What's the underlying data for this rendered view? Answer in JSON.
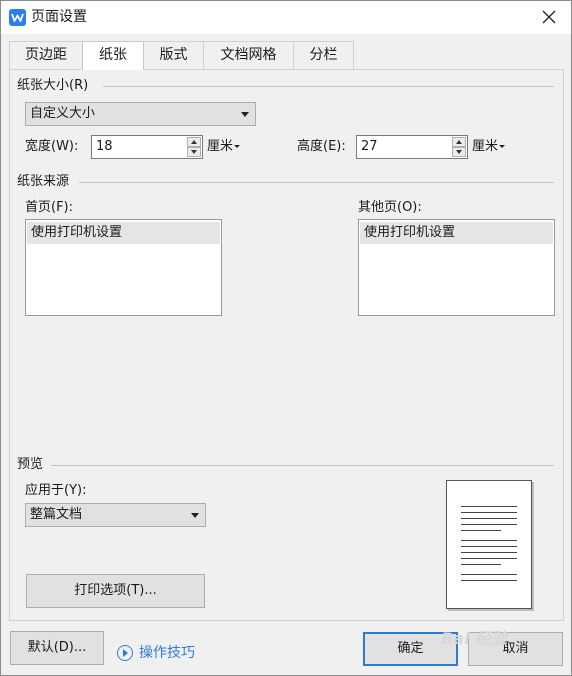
{
  "window": {
    "title": "页面设置"
  },
  "tabs": [
    {
      "label": "页边距"
    },
    {
      "label": "纸张"
    },
    {
      "label": "版式"
    },
    {
      "label": "文档网格"
    },
    {
      "label": "分栏"
    }
  ],
  "active_tab": "纸张",
  "paper_size": {
    "group_label": "纸张大小(R)",
    "selected": "自定义大小",
    "width_label": "宽度(W):",
    "width_value": "18",
    "width_unit": "厘米",
    "height_label": "高度(E):",
    "height_value": "27",
    "height_unit": "厘米"
  },
  "paper_source": {
    "group_label": "纸张来源",
    "first_page_label": "首页(F):",
    "first_page_items": [
      "使用打印机设置"
    ],
    "other_pages_label": "其他页(O):",
    "other_pages_items": [
      "使用打印机设置"
    ]
  },
  "preview": {
    "group_label": "预览",
    "apply_to_label": "应用于(Y):",
    "apply_to_value": "整篇文档",
    "print_options_label": "打印选项(T)..."
  },
  "footer": {
    "default_label": "默认(D)...",
    "tips_label": "操作技巧",
    "ok_label": "确定",
    "cancel_label": "取消"
  },
  "watermark_text": "Bai 经验",
  "colors": {
    "accent": "#2f7cd6",
    "app_icon": "#2f7cf6"
  }
}
